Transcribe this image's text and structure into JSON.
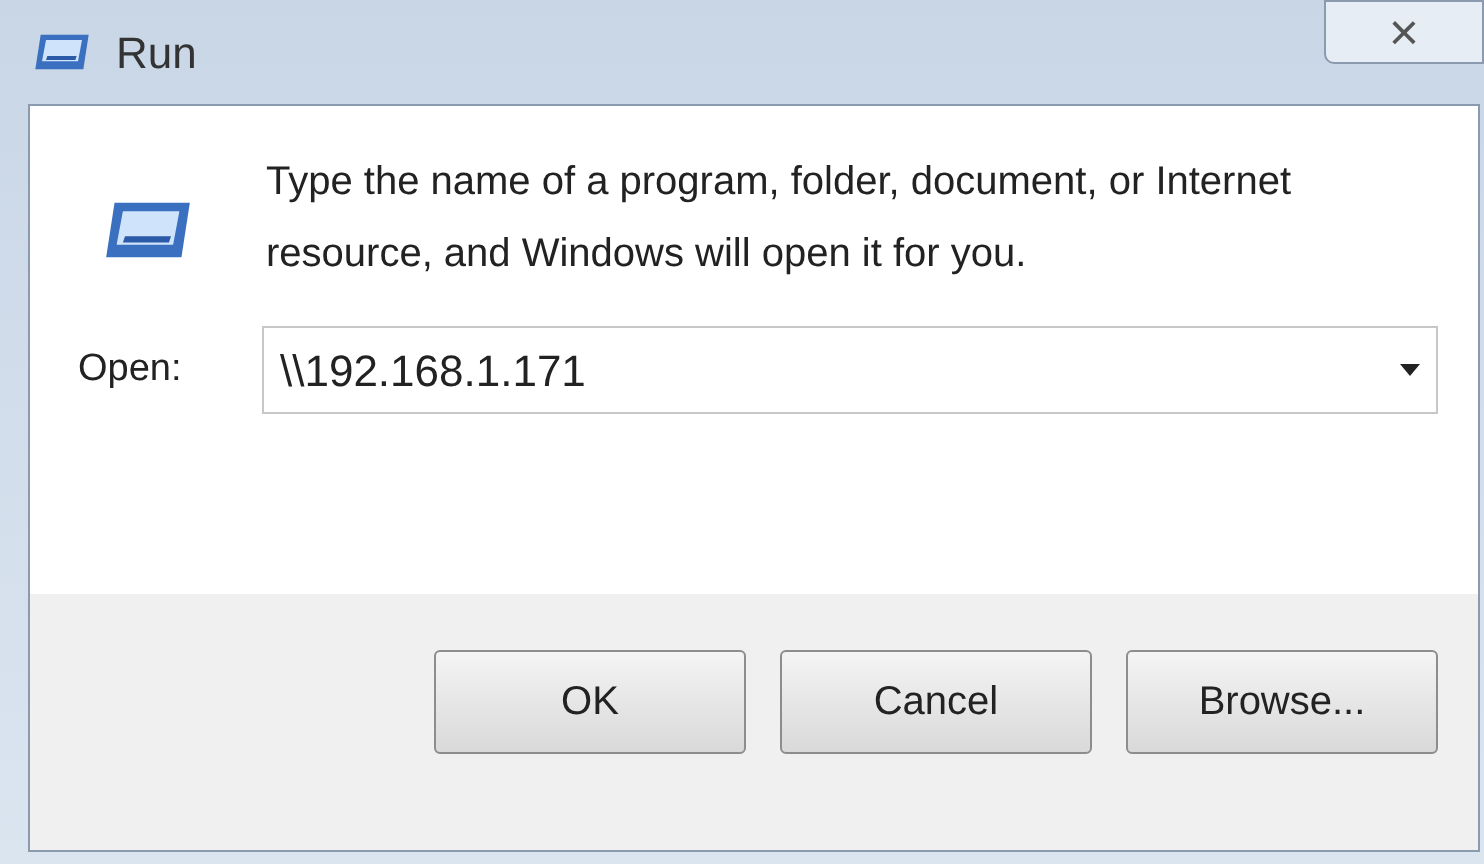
{
  "window": {
    "title": "Run",
    "close": "×"
  },
  "message": "Type the name of a program, folder, document, or Internet resource, and Windows will open it for you.",
  "open_field": {
    "label": "Open:",
    "value": "\\\\192.168.1.171"
  },
  "buttons": [
    {
      "label": "OK"
    },
    {
      "label": "Cancel"
    },
    {
      "label": "Browse..."
    }
  ]
}
